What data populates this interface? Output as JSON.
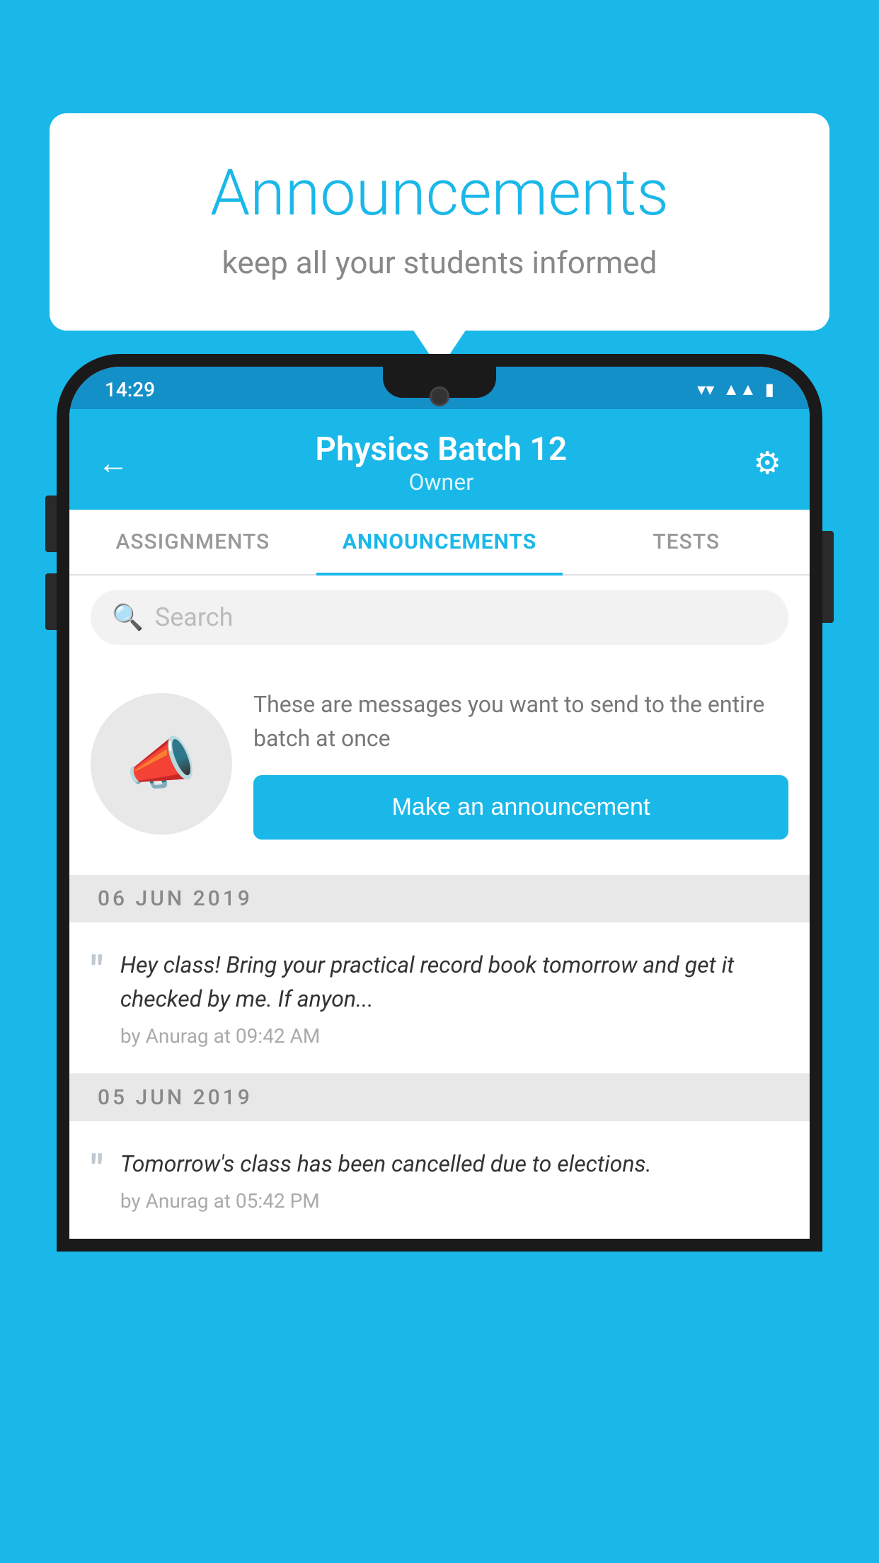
{
  "background_color": "#1ab8e8",
  "speech_bubble": {
    "title": "Announcements",
    "subtitle": "keep all your students informed"
  },
  "phone": {
    "status_bar": {
      "time": "14:29",
      "icons": [
        "wifi",
        "signal",
        "battery"
      ]
    },
    "header": {
      "title": "Physics Batch 12",
      "subtitle": "Owner",
      "back_label": "←",
      "gear_label": "⚙"
    },
    "tabs": [
      {
        "label": "ASSIGNMENTS",
        "active": false
      },
      {
        "label": "ANNOUNCEMENTS",
        "active": true
      },
      {
        "label": "TESTS",
        "active": false
      }
    ],
    "search": {
      "placeholder": "Search"
    },
    "promo": {
      "description": "These are messages you want to send to the entire batch at once",
      "button_label": "Make an announcement"
    },
    "announcements": [
      {
        "date": "06  JUN  2019",
        "text": "Hey class! Bring your practical record book tomorrow and get it checked by me. If anyon...",
        "meta": "by Anurag at 09:42 AM"
      },
      {
        "date": "05  JUN  2019",
        "text": "Tomorrow's class has been cancelled due to elections.",
        "meta": "by Anurag at 05:42 PM"
      }
    ]
  }
}
